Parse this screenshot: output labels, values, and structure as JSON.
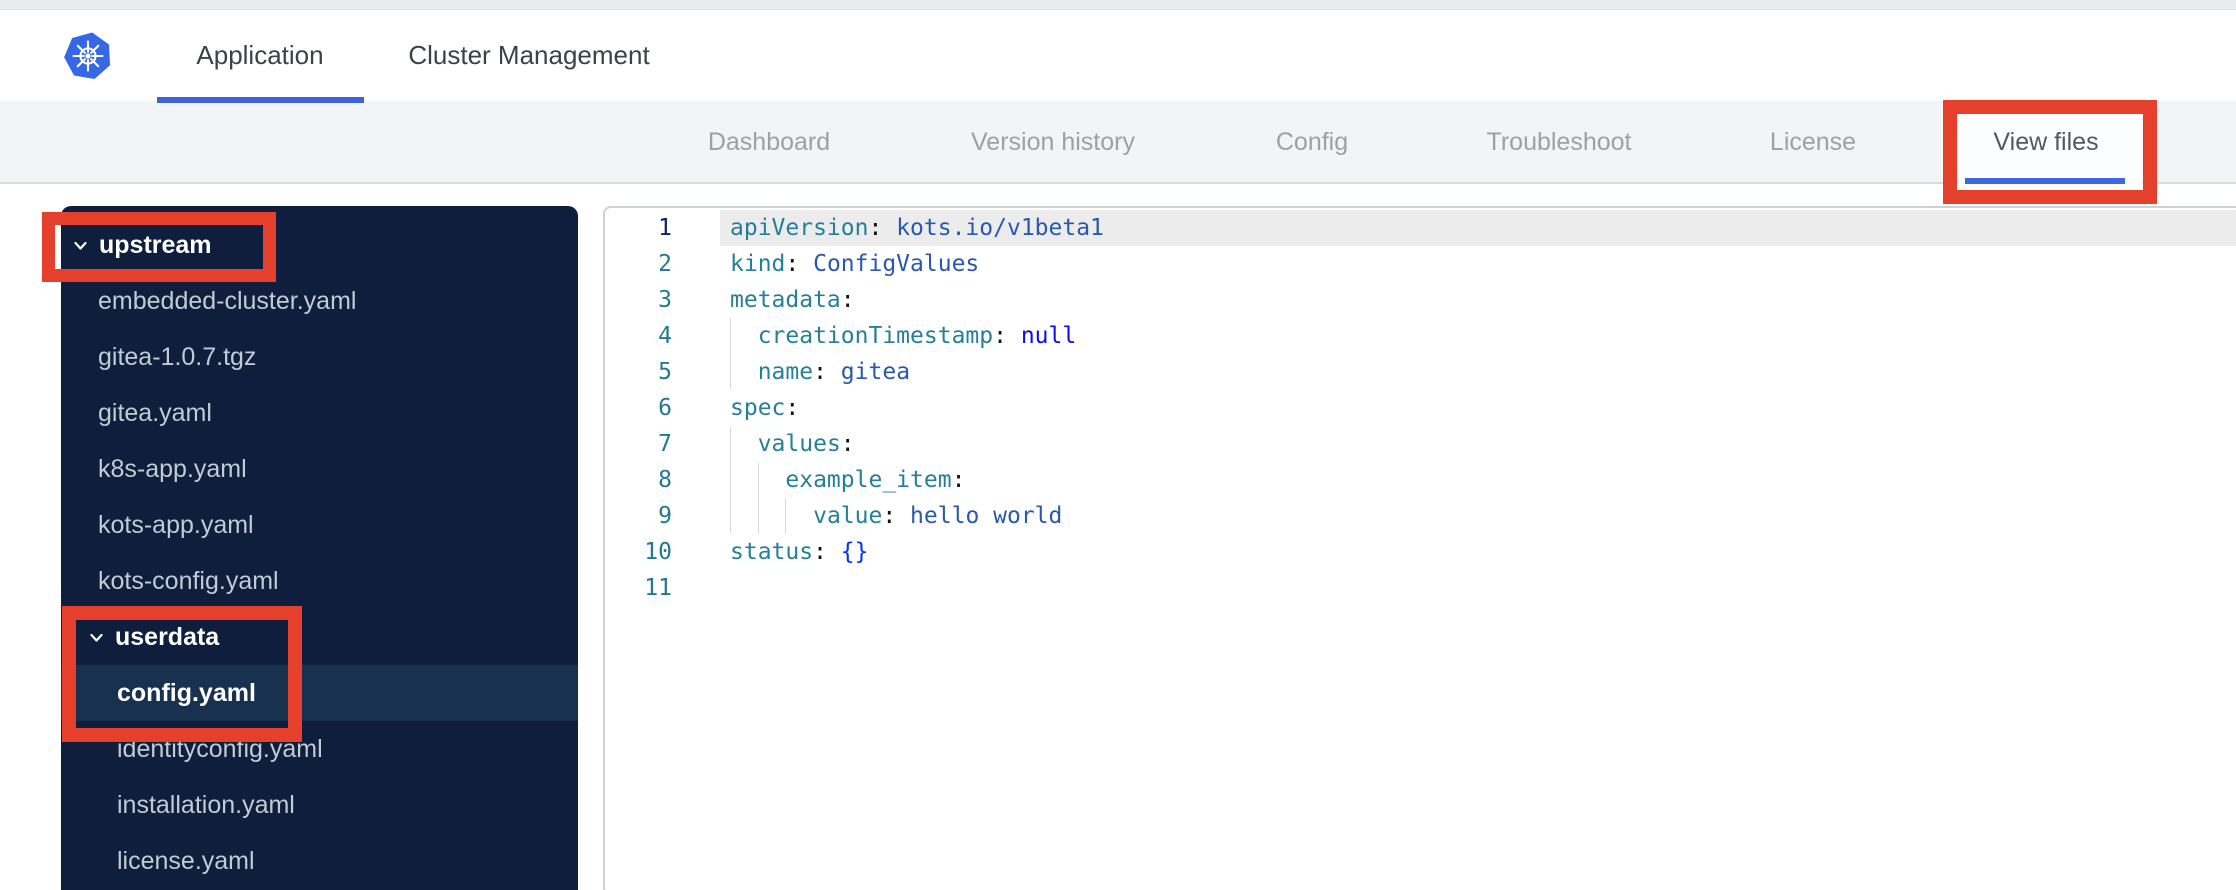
{
  "header": {
    "logo": "kubernetes-logo",
    "tabs": [
      {
        "label": "Application",
        "active": true
      },
      {
        "label": "Cluster Management",
        "active": false
      }
    ]
  },
  "subnav": {
    "items": [
      "Dashboard",
      "Version history",
      "Config",
      "Troubleshoot",
      "License",
      "View files"
    ],
    "active": "View files"
  },
  "sidebar": {
    "items": [
      {
        "type": "folder",
        "label": "upstream",
        "indent": 0,
        "expanded": true,
        "annotated": true
      },
      {
        "type": "file",
        "label": "embedded-cluster.yaml",
        "indent": 1
      },
      {
        "type": "file",
        "label": "gitea-1.0.7.tgz",
        "indent": 1
      },
      {
        "type": "file",
        "label": "gitea.yaml",
        "indent": 1
      },
      {
        "type": "file",
        "label": "k8s-app.yaml",
        "indent": 1
      },
      {
        "type": "file",
        "label": "kots-app.yaml",
        "indent": 1
      },
      {
        "type": "file",
        "label": "kots-config.yaml",
        "indent": 1
      },
      {
        "type": "folder",
        "label": "userdata",
        "indent": 1,
        "expanded": true,
        "annotated": true
      },
      {
        "type": "file",
        "label": "config.yaml",
        "indent": 2,
        "selected": true,
        "annotated": true
      },
      {
        "type": "file",
        "label": "identityconfig.yaml",
        "indent": 2
      },
      {
        "type": "file",
        "label": "installation.yaml",
        "indent": 2
      },
      {
        "type": "file",
        "label": "license.yaml",
        "indent": 2
      }
    ]
  },
  "editor": {
    "language": "yaml",
    "lines": [
      {
        "n": "1",
        "active": true,
        "highlight": true,
        "guides": 0,
        "tokens": [
          [
            "key",
            "apiVersion"
          ],
          [
            "punc",
            ":"
          ],
          [
            "str",
            " kots.io/v1beta1"
          ]
        ]
      },
      {
        "n": "2",
        "guides": 0,
        "tokens": [
          [
            "key",
            "kind"
          ],
          [
            "punc",
            ":"
          ],
          [
            "str",
            " ConfigValues"
          ]
        ]
      },
      {
        "n": "3",
        "guides": 0,
        "tokens": [
          [
            "key",
            "metadata"
          ],
          [
            "punc",
            ":"
          ]
        ]
      },
      {
        "n": "4",
        "guides": 1,
        "tokens": [
          [
            "sp",
            "  "
          ],
          [
            "key",
            "creationTimestamp"
          ],
          [
            "punc",
            ":"
          ],
          [
            "kw",
            " null"
          ]
        ]
      },
      {
        "n": "5",
        "guides": 1,
        "tokens": [
          [
            "sp",
            "  "
          ],
          [
            "key",
            "name"
          ],
          [
            "punc",
            ":"
          ],
          [
            "str",
            " gitea"
          ]
        ]
      },
      {
        "n": "6",
        "guides": 0,
        "tokens": [
          [
            "key",
            "spec"
          ],
          [
            "punc",
            ":"
          ]
        ]
      },
      {
        "n": "7",
        "guides": 1,
        "tokens": [
          [
            "sp",
            "  "
          ],
          [
            "key",
            "values"
          ],
          [
            "punc",
            ":"
          ]
        ]
      },
      {
        "n": "8",
        "guides": 2,
        "tokens": [
          [
            "sp",
            "    "
          ],
          [
            "key",
            "example_item"
          ],
          [
            "punc",
            ":"
          ]
        ]
      },
      {
        "n": "9",
        "guides": 3,
        "tokens": [
          [
            "sp",
            "      "
          ],
          [
            "key",
            "value"
          ],
          [
            "punc",
            ":"
          ],
          [
            "str",
            " hello world"
          ]
        ]
      },
      {
        "n": "10",
        "guides": 0,
        "tokens": [
          [
            "key",
            "status"
          ],
          [
            "punc",
            ":"
          ],
          [
            "brace",
            " {}"
          ]
        ]
      },
      {
        "n": "11",
        "guides": 0,
        "tokens": []
      }
    ]
  },
  "annotations": {
    "color": "#e5402c",
    "boxes": [
      "view-files-tab",
      "upstream-folder",
      "userdata-and-config-yaml"
    ]
  },
  "colors": {
    "accent_blue": "#3e63dd",
    "sidebar_bg": "#0f1e3c",
    "sidebar_selected": "#17314f",
    "logo_blue": "#3568e4",
    "yaml_key": "#267f99",
    "yaml_string": "#2a58ad",
    "yaml_null": "#0c0cf0",
    "line_number": "#237893",
    "line_number_active": "#0b216f"
  }
}
